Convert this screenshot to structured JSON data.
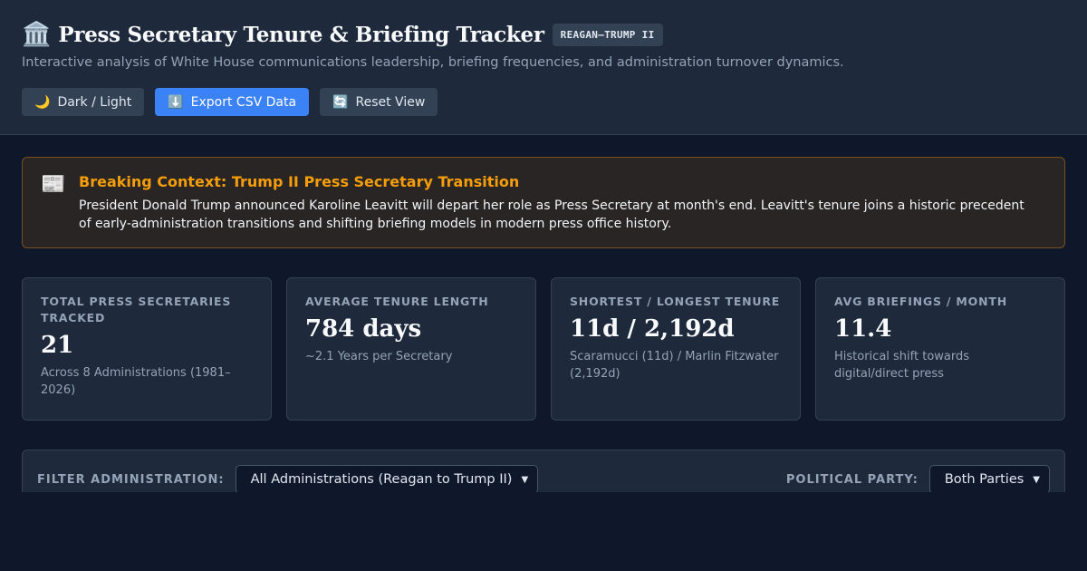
{
  "header": {
    "icon": "🏛️",
    "title": "Press Secretary Tenure & Briefing Tracker",
    "badge": "REAGAN–TRUMP II",
    "subtitle": "Interactive analysis of White House communications leadership, briefing frequencies, and administration turnover dynamics.",
    "buttons": [
      {
        "icon": "🌙",
        "label": "Dark / Light"
      },
      {
        "icon": "⬇️",
        "label": "Export CSV Data"
      },
      {
        "icon": "🔄",
        "label": "Reset View"
      }
    ]
  },
  "alert": {
    "icon": "📰",
    "title": "Breaking Context: Trump II Press Secretary Transition",
    "text": "President Donald Trump announced Karoline Leavitt will depart her role as Press Secretary at month's end. Leavitt's tenure joins a historic precedent of early-administration transitions and shifting briefing models in modern press office history."
  },
  "stats": [
    {
      "label": "Total Press Secretaries Tracked",
      "value": "21",
      "note": "Across 8 Administrations (1981–2026)"
    },
    {
      "label": "Average Tenure Length",
      "value": "784 days",
      "note": "~2.1 Years per Secretary"
    },
    {
      "label": "Shortest / Longest Tenure",
      "value": "11d / 2,192d",
      "note": "Scaramucci (11d) / Marlin Fitzwater (2,192d)"
    },
    {
      "label": "Avg Briefings / Month",
      "value": "11.4",
      "note": "Historical shift towards digital/direct press"
    }
  ],
  "filters": {
    "administration_label": "Filter Administration:",
    "administration_value": "All Administrations (Reagan to Trump II)",
    "party_label": "Political Party:",
    "party_value": "Both Parties"
  },
  "colors": {
    "accent": "#3b82f6",
    "alert_title": "#f59e0b",
    "background": "#0f172a",
    "panel": "#1e293b"
  }
}
